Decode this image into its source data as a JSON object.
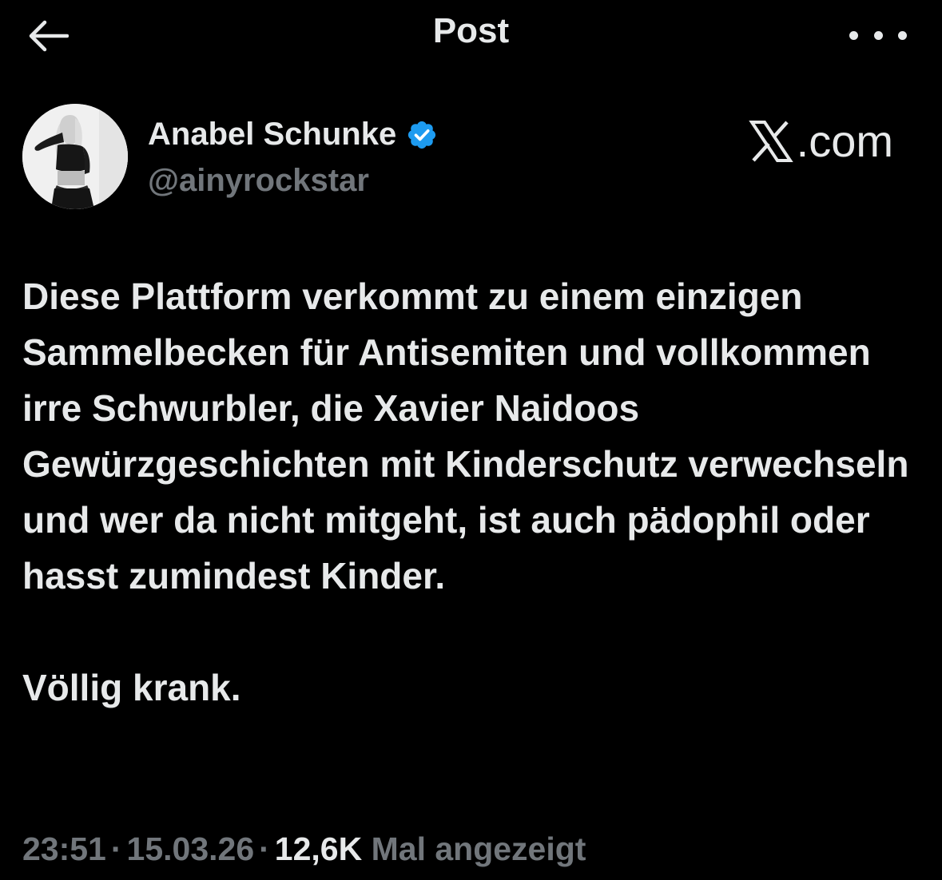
{
  "header": {
    "title": "Post",
    "back_icon": "arrow-left-icon",
    "more_icon": "more-horizontal-icon"
  },
  "author": {
    "display_name": "Anabel Schunke",
    "handle": "@ainyrockstar",
    "verified": true,
    "verified_color": "#1d9bf0",
    "avatar": "avatar-photo"
  },
  "watermark": {
    "text": ".com",
    "logo_icon": "x-logo-icon"
  },
  "post": {
    "paragraphs": [
      "Diese Plattform verkommt zu einem einzigen Sammelbecken für Antisemiten und vollkommen irre Schwurbler, die Xavier Naidoos Gewürzgeschichten mit Kinderschutz verwechseln und wer da nicht mitgeht, ist auch pädophil oder hasst zumindest Kinder.",
      "Völlig krank."
    ]
  },
  "meta": {
    "time": "23:51",
    "date": "15.03.26",
    "separator": "·",
    "views_count": "12,6K",
    "views_label": "Mal angezeigt"
  },
  "colors": {
    "background": "#000000",
    "text_primary": "#e7e9ea",
    "text_secondary": "#71767b"
  }
}
